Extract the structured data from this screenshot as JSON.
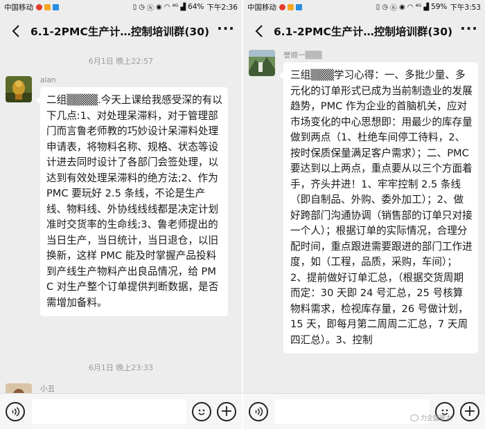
{
  "left": {
    "status": {
      "carrier": "中国移动",
      "signal": "⁴ᴳ",
      "battery": "64%",
      "time": "下午2:36"
    },
    "nav": {
      "title": "6.1-2PMC生产计…控制培训群(30)",
      "more": "···"
    },
    "timestamp1": "6月1日 晚上22:57",
    "message": {
      "sender": "alan",
      "text": "二组▒▒▒▒.今天上课给我感受深的有以下几点:1、对处理呆滞料，对于管理部门而言鲁老师教的巧妙设计呆滞料处理申请表，将物料名称、规格、状态等设计进去同时设计了各部门会签处理，以达到有效处理呆滞料的绝方法;2、作为 PMC 要玩好 2.5 条线，不论是生产线、物料线、外协线线线都是决定计划准时交货率的生命线;3、鲁老师提出的当日生产，当日统计，当日退仓，以旧换新，这样 PMC 能及时掌握产品投料到产线生产物料产出良品情况，给 PMC 对生产整个订单提供判断数据，是否需增加备料。"
    },
    "timestamp2": "6月1日 晚上23:33",
    "next_sender": "小丑"
  },
  "right": {
    "status": {
      "carrier": "中国移动",
      "signal": "⁴ᴳ",
      "battery": "59%",
      "time": "下午3:53"
    },
    "nav": {
      "title": "6.1-2PMC生产计…控制培训群(30)",
      "more": "···"
    },
    "message": {
      "sender": "誉顺一▒▒▒",
      "text": "三组▒▒▒学习心得：一、多批少量、多元化的订单形式已成为当前制造业的发展趋势，PMC 作为企业的首脑机关，应对市场变化的中心思想即：用最少的库存量做到两点（1、杜绝车间停工待料，2、按时保质保量满足客户需求）；二、PMC 要达到以上两点，重点要从以三个方面着手，齐头并进！1、牢牢控制 2.5 条线（即自制品、外购、委外加工）；2、做好跨部门沟通协调（销售部的订单只对接一个人）；根据订单的实际情况，合理分配时间，重点跟进需要跟进的部门工作进度，如（工程，品质，采购，车间）；2、提前做好订单汇总，（根据交货周期而定：30 天即 24 号汇总，25 号核算物料需求，检视库存量，26 号做计划，15 天，即每月第二周周二汇总，7 天周四汇总）。3、控制"
    }
  },
  "watermark": "力企盛管大"
}
